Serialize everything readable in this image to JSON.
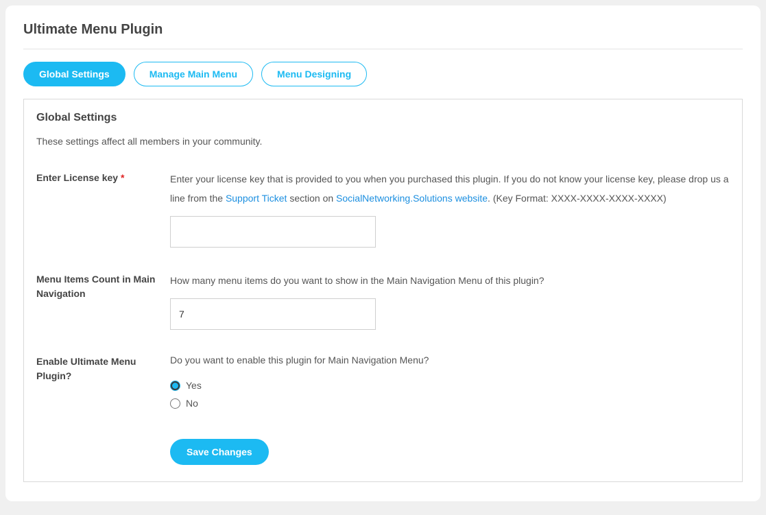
{
  "page": {
    "title": "Ultimate Menu Plugin"
  },
  "tabs": [
    {
      "label": "Global Settings",
      "active": true
    },
    {
      "label": "Manage Main Menu",
      "active": false
    },
    {
      "label": "Menu Designing",
      "active": false
    }
  ],
  "panel": {
    "title": "Global Settings",
    "description": "These settings affect all members in your community."
  },
  "fields": {
    "license": {
      "label": "Enter License key",
      "required_marker": "*",
      "help_1": "Enter your license key that is provided to you when you purchased this plugin. If you do not know your license key, please drop us a line from the ",
      "link1": "Support Ticket",
      "help_2": " section on ",
      "link2": "SocialNetworking.Solutions website",
      "help_3": ". (Key Format: XXXX-XXXX-XXXX-XXXX)",
      "value": ""
    },
    "menu_count": {
      "label": "Menu Items Count in Main Navigation",
      "help": "How many menu items do you want to show in the Main Navigation Menu of this plugin?",
      "value": "7"
    },
    "enable_plugin": {
      "label": "Enable Ultimate Menu Plugin?",
      "help": "Do you want to enable this plugin for Main Navigation Menu?",
      "option_yes": "Yes",
      "option_no": "No",
      "selected": "yes"
    }
  },
  "actions": {
    "save": "Save Changes"
  }
}
